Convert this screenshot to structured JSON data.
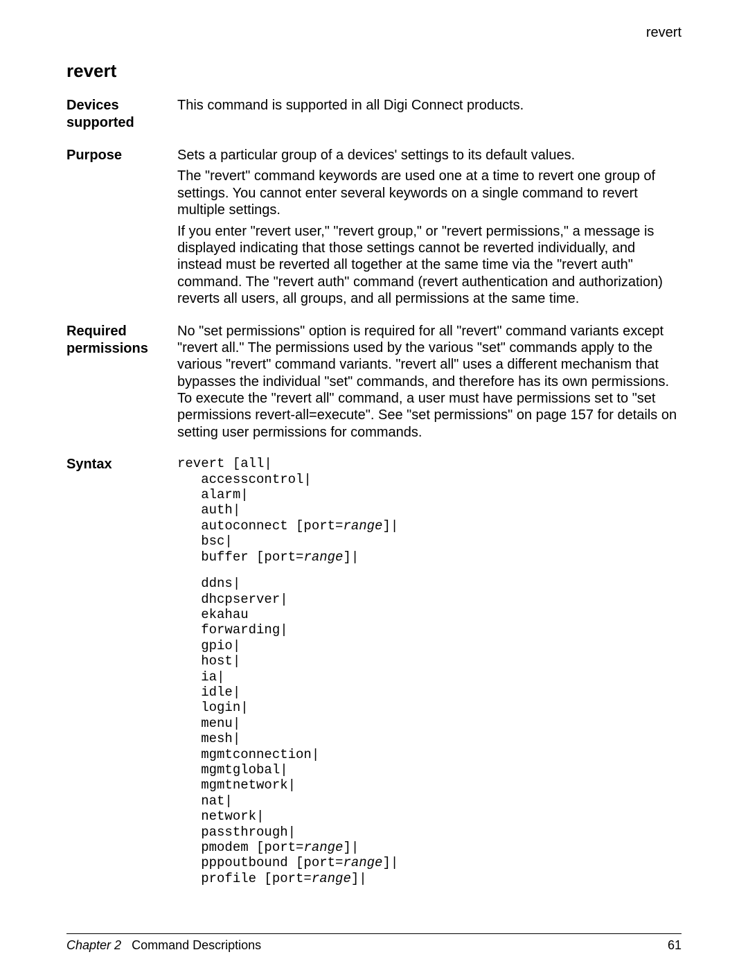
{
  "running_header": "revert",
  "title": "revert",
  "sections": {
    "devices": {
      "label": "Devices supported",
      "p1": "This command is supported in all Digi Connect products."
    },
    "purpose": {
      "label": "Purpose",
      "p1": "Sets a particular group of a devices' settings to its default values.",
      "p2": "The \"revert\" command keywords are used one at a time to revert one group of settings. You cannot enter several keywords on a single command to revert multiple settings.",
      "p3": "If you enter \"revert user,\" \"revert group,\" or \"revert permissions,\" a message is displayed indicating that those settings cannot be reverted individually, and instead must be reverted all together at the same time via the \"revert auth\" command. The \"revert auth\" command (revert authentication and authorization) reverts all users, all groups, and all permissions at the same time."
    },
    "required": {
      "label": "Required permissions",
      "p1": "No \"set permissions\" option is required for all \"revert\" command variants except \"revert all.\" The permissions used by the various \"set\" commands apply to the various \"revert\" command variants. \"revert all\" uses a different mechanism that bypasses the individual \"set\" commands, and therefore has its own permissions. To execute the \"revert all\" command, a user must have permissions set to \"set permissions revert-all=execute\". See \"set permissions\" on page 157 for details on setting user permissions for commands."
    },
    "syntax": {
      "label": "Syntax",
      "l01": "revert [all|",
      "l02": "   accesscontrol|",
      "l03": "   alarm|",
      "l04": "   auth|",
      "l05a": "   autoconnect [port=",
      "l05b": "range",
      "l05c": "]|",
      "l06": "   bsc|",
      "l07a": "   buffer [port=",
      "l07b": "range",
      "l07c": "]|",
      "l08": "   ddns|",
      "l09": "   dhcpserver|",
      "l10": "   ekahau",
      "l11": "   forwarding|",
      "l12": "   gpio|",
      "l13": "   host|",
      "l14": "   ia|",
      "l15": "   idle|",
      "l16": "   login|",
      "l17": "   menu|",
      "l18": "   mesh|",
      "l19": "   mgmtconnection|",
      "l20": "   mgmtglobal|",
      "l21": "   mgmtnetwork|",
      "l22": "   nat|",
      "l23": "   network|",
      "l24": "   passthrough|",
      "l25a": "   pmodem [port=",
      "l25b": "range",
      "l25c": "]|",
      "l26a": "   pppoutbound [port=",
      "l26b": "range",
      "l26c": "]|",
      "l27a": "   profile [port=",
      "l27b": "range",
      "l27c": "]|"
    }
  },
  "footer": {
    "chapter_italic": "Chapter 2",
    "chapter_rest": "Command Descriptions",
    "page": "61"
  }
}
